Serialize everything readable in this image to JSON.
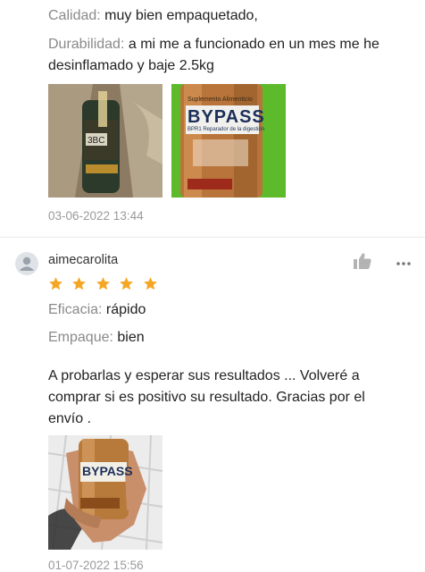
{
  "review1": {
    "quality_label": "Calidad:",
    "quality_value": "muy bien empaquetado,",
    "durability_label": "Durabilidad:",
    "durability_value_line1": "a mi me a funcionado en un mes me he",
    "durability_value_line2": "desinflamado y baje 2.5kg",
    "photo_text": "BYPASS",
    "photo_subtext": "BPR1 Reparador de la digestión",
    "photo_header": "Suplemento Alimenticio",
    "date": "03-06-2022 13:44"
  },
  "review2": {
    "username": "aimecarolita",
    "rating": 5,
    "efficacy_label": "Eficacia:",
    "efficacy_value": "rápido",
    "packaging_label": "Empaque:",
    "packaging_value": "bien",
    "comment_line1": "A probarlas y esperar sus resultados ... Volveré a",
    "comment_line2": "comprar si es positivo su resultado. Gracias por el",
    "comment_line3": "envío .",
    "photo_text": "BYPASS",
    "date": "01-07-2022 15:56"
  },
  "colors": {
    "star": "#f5a623",
    "label": "#8a8a8a",
    "text": "#222222"
  },
  "icons": {
    "like": "thumbs-up-icon",
    "more": "more-horizontal-icon",
    "avatar": "user-icon"
  }
}
